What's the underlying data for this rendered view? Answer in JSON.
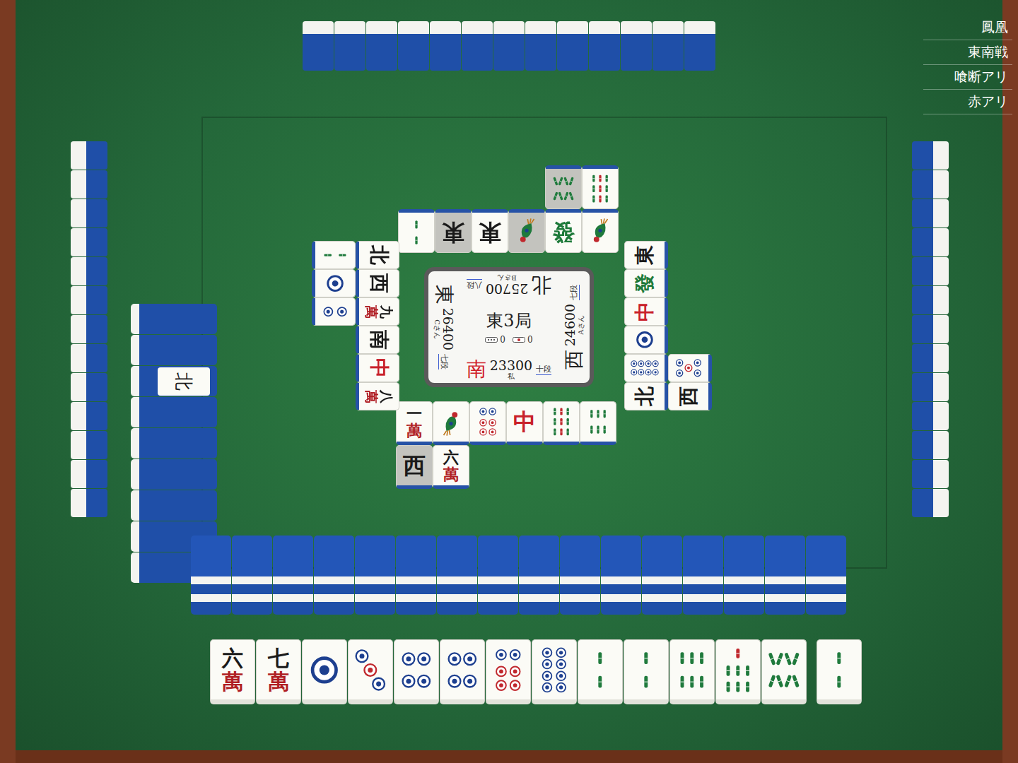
{
  "rules": [
    "鳳凰",
    "東南戦",
    "喰断アリ",
    "赤アリ"
  ],
  "round": "東3局",
  "counters": [
    {
      "kind": "honba",
      "value": "0"
    },
    {
      "kind": "riichi",
      "value": "0"
    }
  ],
  "players": [
    {
      "seat": "南",
      "score": "23300",
      "name": "私",
      "rank": "十段",
      "self": true,
      "pond": [
        [
          {
            "kind": "man",
            "rank": "一",
            "suit": "萬",
            "dim": false
          },
          {
            "kind": "sou",
            "value": 1,
            "dim": false
          },
          {
            "kind": "pin",
            "value": 6,
            "dim": false
          },
          {
            "kind": "honor",
            "text": "中",
            "color": "#c8202a",
            "dim": false
          },
          {
            "kind": "sou",
            "value": 9,
            "dim": false
          },
          {
            "kind": "sou",
            "value": 6,
            "dim": false
          }
        ],
        [
          {
            "kind": "honor",
            "text": "西",
            "color": "#1a1a1a",
            "dim": true
          },
          {
            "kind": "man",
            "rank": "六",
            "suit": "萬",
            "dim": false
          }
        ]
      ]
    },
    {
      "seat": "西",
      "score": "24600",
      "name": "Aさん",
      "rank": "七段",
      "self": false,
      "pond": [
        [
          {
            "kind": "honor",
            "text": "北",
            "color": "#1a1a1a",
            "dim": false
          },
          {
            "kind": "pin",
            "value": 8,
            "dim": false
          },
          {
            "kind": "pin",
            "value": 1,
            "dim": false
          },
          {
            "kind": "honor",
            "text": "中",
            "color": "#c8202a",
            "dim": false
          },
          {
            "kind": "honor",
            "text": "發",
            "color": "#1e7a3a",
            "dim": false
          },
          {
            "kind": "honor",
            "text": "東",
            "color": "#1a1a1a",
            "dim": false
          }
        ],
        [
          {
            "kind": "honor",
            "text": "西",
            "color": "#1a1a1a",
            "dim": false
          },
          {
            "kind": "pin",
            "value": 5,
            "dim": false
          }
        ]
      ]
    },
    {
      "seat": "北",
      "score": "25700",
      "name": "Bさん",
      "rank": "八段",
      "self": false,
      "pond": [
        [
          {
            "kind": "sou",
            "value": 1,
            "dim": false
          },
          {
            "kind": "honor",
            "text": "發",
            "color": "#1e7a3a",
            "dim": false
          },
          {
            "kind": "sou",
            "value": 1,
            "dim": true
          },
          {
            "kind": "honor",
            "text": "東",
            "color": "#1a1a1a",
            "dim": false
          },
          {
            "kind": "honor",
            "text": "東",
            "color": "#1a1a1a",
            "dim": true
          },
          {
            "kind": "sou",
            "value": 2,
            "dim": false
          }
        ],
        [
          {
            "kind": "sou",
            "value": 9,
            "dim": false
          },
          {
            "kind": "sou",
            "value": 8,
            "dim": true
          }
        ]
      ]
    },
    {
      "seat": "東",
      "score": "26400",
      "name": "Cさん",
      "rank": "七段",
      "self": false,
      "pond": [
        [
          {
            "kind": "honor",
            "text": "北",
            "color": "#1a1a1a",
            "dim": false
          },
          {
            "kind": "honor",
            "text": "西",
            "color": "#1a1a1a",
            "dim": false
          },
          {
            "kind": "man",
            "rank": "九",
            "suit": "萬",
            "dim": false
          },
          {
            "kind": "honor",
            "text": "南",
            "color": "#1a1a1a",
            "dim": false
          },
          {
            "kind": "honor",
            "text": "中",
            "color": "#c8202a",
            "dim": false
          },
          {
            "kind": "man",
            "rank": "八",
            "suit": "萬",
            "dim": false
          }
        ],
        [
          {
            "kind": "sou",
            "value": 2,
            "dim": false
          },
          {
            "kind": "pin",
            "value": 1,
            "dim": false
          },
          {
            "kind": "pin",
            "value": 2,
            "dim": false
          }
        ]
      ]
    }
  ],
  "hand": [
    {
      "kind": "man",
      "rank": "六",
      "suit": "萬"
    },
    {
      "kind": "man",
      "rank": "七",
      "suit": "萬"
    },
    {
      "kind": "pin",
      "value": 1
    },
    {
      "kind": "pin",
      "value": 3
    },
    {
      "kind": "pin",
      "value": 4
    },
    {
      "kind": "pin",
      "value": 4
    },
    {
      "kind": "pin",
      "value": 6
    },
    {
      "kind": "pin",
      "value": 8
    },
    {
      "kind": "sou",
      "value": 2
    },
    {
      "kind": "sou",
      "value": 2
    },
    {
      "kind": "sou",
      "value": 6
    },
    {
      "kind": "sou",
      "value": 7
    },
    {
      "kind": "sou",
      "value": 8
    }
  ],
  "draw": {
    "kind": "sou",
    "value": 2
  },
  "dora_indicators": [
    {
      "kind": "honor",
      "text": "北",
      "color": "#1a1a1a"
    }
  ]
}
